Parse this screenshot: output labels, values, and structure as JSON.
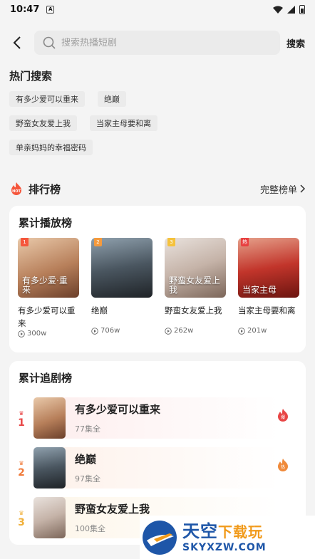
{
  "status_bar": {
    "time": "10:47",
    "notif_letter": "A"
  },
  "search": {
    "placeholder": "搜索热播短剧",
    "button_label": "搜索"
  },
  "hot_search": {
    "title": "热门搜索",
    "tags": [
      "有多少爱可以重来",
      "绝巅",
      "野蛮女友爱上我",
      "当家主母要和离",
      "单亲妈妈的幸福密码"
    ]
  },
  "ranking": {
    "title": "排行榜",
    "badge_text": "HOT",
    "full_list_label": "完整榜单",
    "play_board": {
      "title": "累计播放榜",
      "items": [
        {
          "rank": "1",
          "name": "有多少爱可以重来",
          "plays": "300w",
          "caption": "有多少爱·重来",
          "rank_color": "#f5563c"
        },
        {
          "rank": "2",
          "name": "绝巅",
          "plays": "706w",
          "caption": "",
          "rank_color": "#f59a3c"
        },
        {
          "rank": "3",
          "name": "野蛮女友爱上我",
          "plays": "262w",
          "caption": "野蛮女友爱上我",
          "rank_color": "#f5c23c"
        },
        {
          "rank": "热",
          "name": "当家主母要和离",
          "plays": "201w",
          "caption": "当家主母",
          "rank_color": "#e84040"
        }
      ]
    },
    "chase_board": {
      "title": "累计追剧榜",
      "items": [
        {
          "rank": "1",
          "name": "有多少爱可以重来",
          "episodes": "77集全",
          "rank_color": "#e84545",
          "bg": "#fdeeee",
          "fire": "#e84545",
          "fire_label": "爆"
        },
        {
          "rank": "2",
          "name": "绝巅",
          "episodes": "97集全",
          "rank_color": "#f07a3a",
          "bg": "#fdf1ea",
          "fire": "#f08a3a",
          "fire_label": "热"
        },
        {
          "rank": "3",
          "name": "野蛮女友爱上我",
          "episodes": "100集全",
          "rank_color": "#f0b03a",
          "bg": "#fdf6ea",
          "fire": "#f0b03a",
          "fire_label": ""
        }
      ]
    }
  },
  "watermark": {
    "cn_main": "天空",
    "cn_sub": "下载玩",
    "en": "SKYXZW.COM"
  },
  "colors": {
    "accent": "#f5563c",
    "brand_blue": "#1e56a8"
  }
}
